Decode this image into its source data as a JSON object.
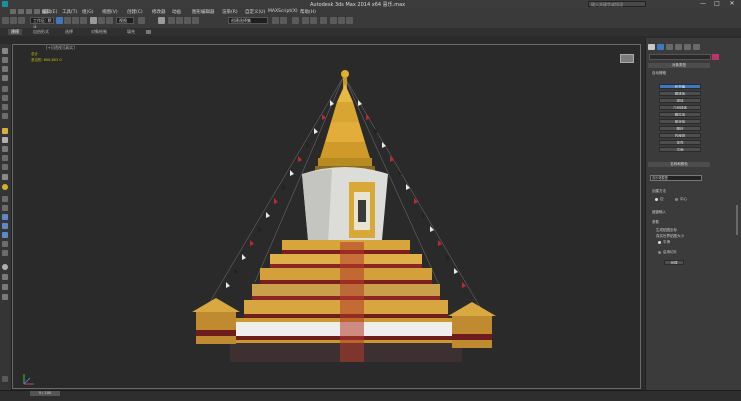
{
  "window": {
    "title": "Autodesk 3ds Max 2014 x64     喜乐.max",
    "search_placeholder": "键入关键字或短语",
    "minimize": "—",
    "maximize": "□",
    "close": "✕"
  },
  "menu": {
    "items": [
      "编辑(E)",
      "工具(T)",
      "组(G)",
      "视图(V)",
      "创建(C)",
      "修改器",
      "动画",
      "图形编辑器",
      "渲染(R)",
      "自定义(U)",
      "MAXScript(X)",
      "帮助(H)"
    ]
  },
  "toolbar": {
    "selection_set": "工作区: 默认",
    "coord_dropdown": "视图",
    "named_selection": "创建选择集"
  },
  "ribbon": {
    "tabs": [
      "建模",
      "自由形式",
      "选择",
      "对象绘制",
      "填充"
    ]
  },
  "viewport": {
    "label": "[+][透视][真实]",
    "stats_label": "总计",
    "stats_value": "多边形: 606,603   0"
  },
  "command_panel": {
    "rollout_type": "对象类型",
    "autogrid": "自动栅格",
    "buttons": [
      "长方体",
      "圆锥体",
      "球体",
      "几何球体",
      "圆柱体",
      "管状体",
      "圆环",
      "四棱锥",
      "茶壶",
      "平面"
    ],
    "name_color_rollout": "名称和颜色",
    "name_value": "喜乐塔模型",
    "creation_method": "创建方法",
    "radio_edge": "边",
    "radio_center": "中心",
    "keyboard_entry": "键盘输入",
    "parameters": "参数",
    "generate_uv": "生成贴图坐标",
    "real_world": "真实世界贴图大小",
    "smooth": "平滑",
    "slice_on": "启用切片",
    "create_button": "创建"
  },
  "timeline": {
    "frame": "0 / 100"
  },
  "colors": {
    "accent": "#3e77c2",
    "viewport_bg": "#2a2a2a",
    "panel_bg": "#3b3b3b",
    "stats_yellow": "#c9c400",
    "object_color": "#c0306a"
  },
  "icons": [
    "app-icon",
    "undo-icon",
    "redo-icon",
    "select-icon",
    "move-icon",
    "rotate-icon",
    "scale-icon",
    "snap-icon",
    "render-icon",
    "create-icon",
    "modify-icon",
    "hierarchy-icon",
    "motion-icon",
    "display-icon",
    "utilities-icon"
  ]
}
